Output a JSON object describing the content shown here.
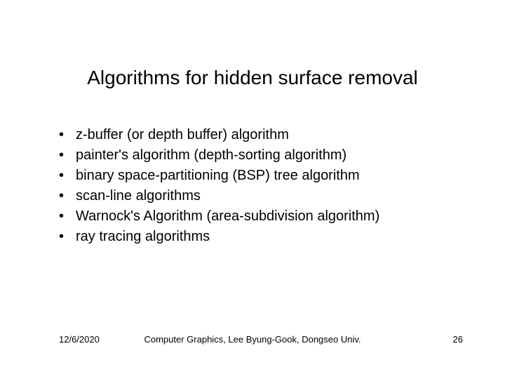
{
  "title": "Algorithms for hidden surface removal",
  "bullets": [
    "z-buffer (or depth buffer) algorithm",
    "painter's algorithm (depth-sorting algorithm)",
    "binary space-partitioning (BSP) tree algorithm",
    "scan-line algorithms",
    "Warnock's Algorithm (area-subdivision algorithm)",
    "ray tracing algorithms"
  ],
  "footer": {
    "date": "12/6/2020",
    "center": "Computer Graphics, Lee Byung-Gook, Dongseo Univ.",
    "page": "26"
  }
}
